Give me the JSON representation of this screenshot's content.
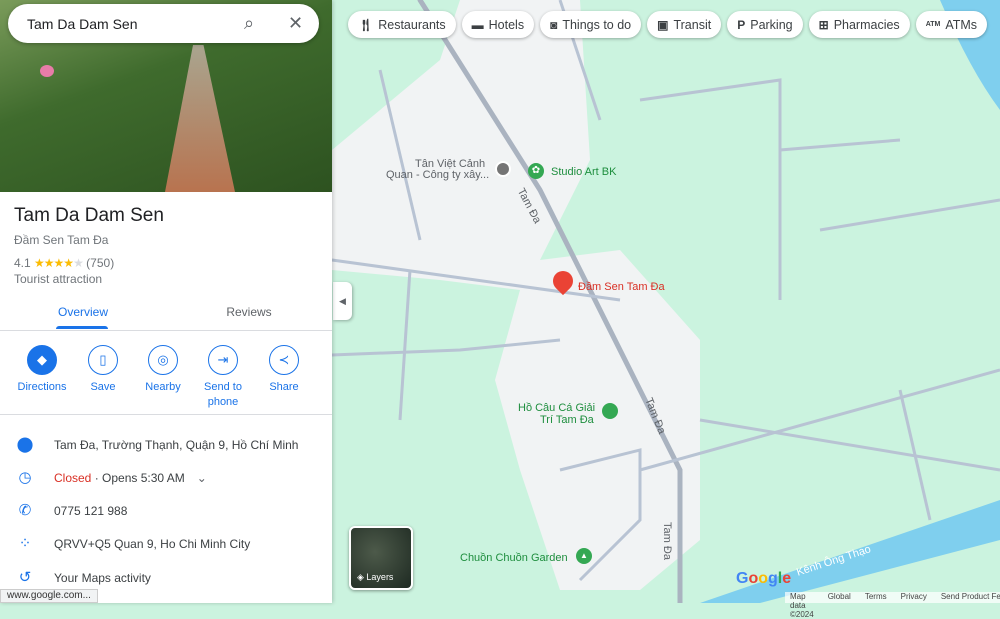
{
  "search": {
    "value": "Tam Da Dam Sen"
  },
  "place": {
    "title": "Tam Da Dam Sen",
    "subtitle": "Đầm Sen Tam Đa",
    "rating": "4.1",
    "stars": "★★★★",
    "star_off": "★",
    "reviews": "(750)",
    "category": "Tourist attraction"
  },
  "tabs": [
    {
      "label": "Overview"
    },
    {
      "label": "Reviews"
    }
  ],
  "actions": [
    {
      "label": "Directions"
    },
    {
      "label": "Save"
    },
    {
      "label": "Nearby"
    },
    {
      "label": "Send to phone"
    },
    {
      "label": "Share"
    }
  ],
  "info": {
    "address": "Tam Đa, Trường Thạnh, Quận 9, Hồ Chí Minh",
    "status": "Closed",
    "hours": " · Opens 5:30 AM",
    "phone": "0775 121 988",
    "pluscode": "QRVV+Q5 Quan 9, Ho Chi Minh City",
    "activity": "Your Maps activity"
  },
  "chips": [
    {
      "label": "Restaurants",
      "icon": "fork-knife-icon"
    },
    {
      "label": "Hotels",
      "icon": "bed-icon"
    },
    {
      "label": "Things to do",
      "icon": "camera-icon"
    },
    {
      "label": "Transit",
      "icon": "bus-icon"
    },
    {
      "label": "Parking",
      "icon": "parking-icon"
    },
    {
      "label": "Pharmacies",
      "icon": "pharmacy-icon"
    },
    {
      "label": "ATMs",
      "icon": "atm-icon"
    }
  ],
  "map": {
    "labels": {
      "tan_viet_1": "Tân Việt Cảnh",
      "tan_viet_2": "Quan - Công ty xây...",
      "studio": "Studio Art BK",
      "pin": "Đầm Sen Tam Đa",
      "ho_cau_1": "Hồ Câu Cá Giải",
      "ho_cau_2": "Trí Tam Đa",
      "chuon": "Chuồn Chuồn Garden",
      "road1": "Tam Đa",
      "road2": "Tam Đa",
      "road3": "Tam Đa",
      "canal": "Kênh Ông Thạo"
    },
    "layers": "Layers",
    "logo": "Google",
    "attribution": [
      "Map data ©2024",
      "Global",
      "Terms",
      "Privacy",
      "Send Product Feedback"
    ]
  },
  "statusbar": "www.google.com...",
  "colors": {
    "accent": "#1a73e8",
    "closed": "#d93025",
    "pin": "#ea4335",
    "park": "#cbf3df",
    "water": "#7fcfee"
  }
}
